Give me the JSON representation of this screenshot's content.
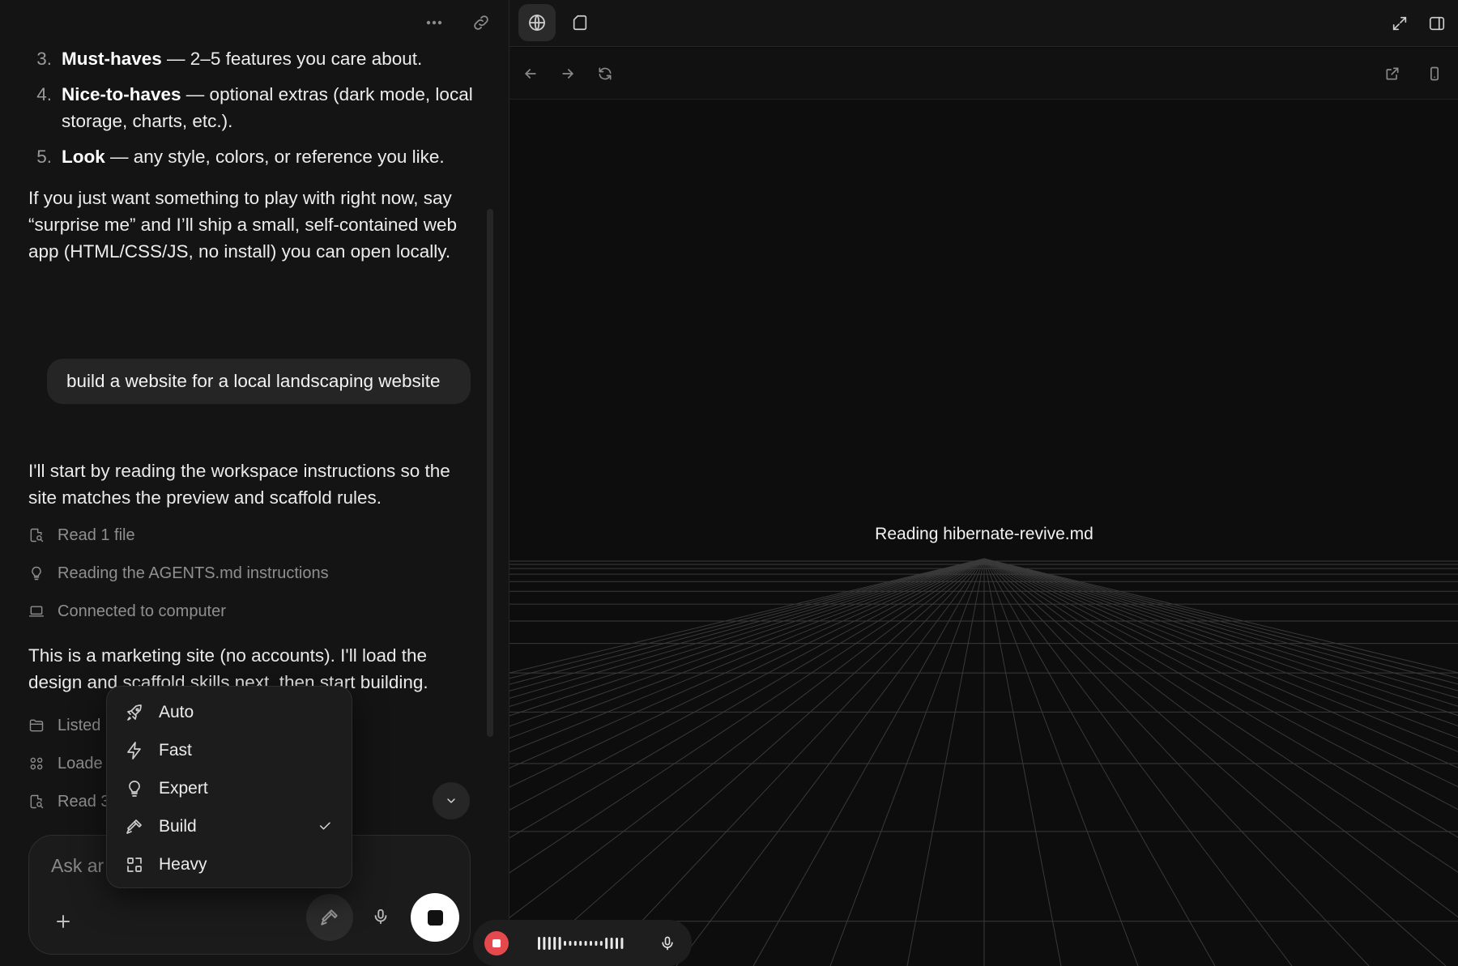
{
  "chat": {
    "requirements": [
      {
        "num": "3.",
        "title": "Must-haves",
        "desc": " — 2–5 features you care about."
      },
      {
        "num": "4.",
        "title": "Nice-to-haves",
        "desc": " — optional extras (dark mode, local storage, charts, etc.)."
      },
      {
        "num": "5.",
        "title": "Look",
        "desc": " — any style, colors, or reference you like."
      }
    ],
    "assistant_intro": "If you just want something to play with right now, say “surprise me” and I’ll ship a small, self-contained web app (HTML/CSS/JS, no install) you can open locally.",
    "user_message": "build a website for a local landscaping website",
    "assistant_reply_1": "I'll start by reading the workspace instructions so the site matches the preview and scaffold rules.",
    "steps_1": [
      {
        "icon": "file-search-icon",
        "label": "Read 1 file"
      },
      {
        "icon": "lightbulb-icon",
        "label": "Reading the AGENTS.md instructions"
      },
      {
        "icon": "laptop-icon",
        "label": "Connected to computer"
      }
    ],
    "assistant_reply_2": "This is a marketing site (no accounts). I'll load the design and scaffold skills next, then start building.",
    "steps_2": [
      {
        "icon": "folder-icon",
        "label": "Listed"
      },
      {
        "icon": "grid-icon",
        "label": "Loade"
      },
      {
        "icon": "file-search-icon",
        "label": "Read 3"
      }
    ],
    "composer_placeholder": "Ask ar"
  },
  "mode_menu": {
    "items": [
      {
        "icon": "rocket-icon",
        "label": "Auto",
        "selected": false
      },
      {
        "icon": "bolt-icon",
        "label": "Fast",
        "selected": false
      },
      {
        "icon": "lightbulb-icon",
        "label": "Expert",
        "selected": false
      },
      {
        "icon": "hammer-icon",
        "label": "Build",
        "selected": true
      },
      {
        "icon": "scan-icon",
        "label": "Heavy",
        "selected": false
      }
    ]
  },
  "preview": {
    "status": "Reading hibernate-revive.md"
  },
  "colors": {
    "background": "#141414",
    "preview_background": "#0d0d0d",
    "record_red": "#e5484d",
    "stop_button": "#ffffff"
  }
}
